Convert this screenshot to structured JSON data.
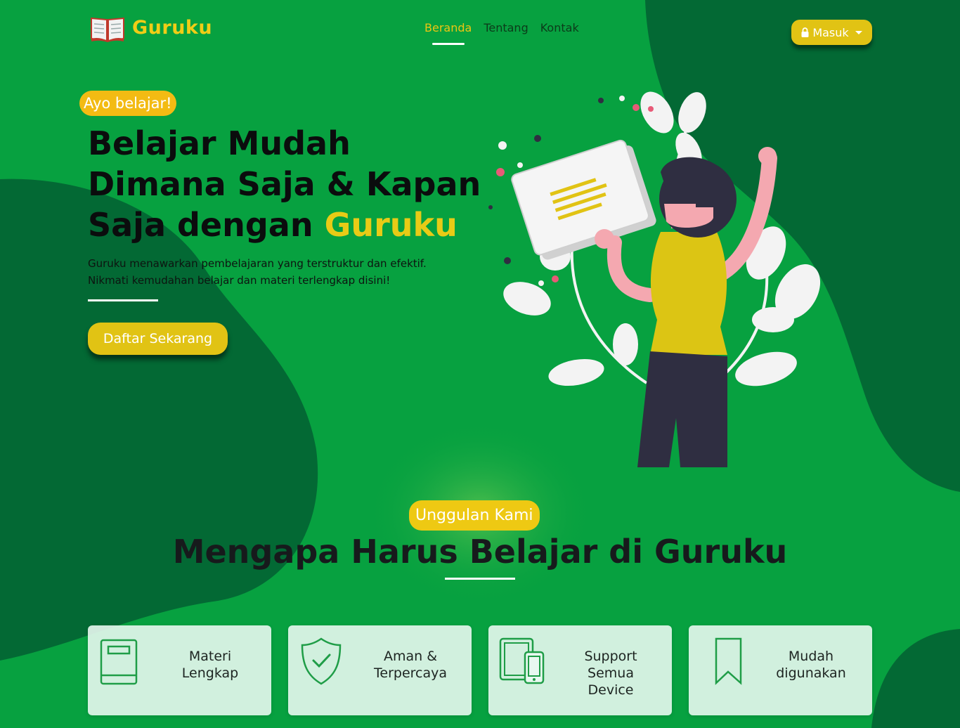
{
  "brand": {
    "name": "Guruku",
    "icon": "open-book-icon"
  },
  "nav": {
    "items": [
      "Beranda",
      "Tentang",
      "Kontak"
    ],
    "active": "Beranda"
  },
  "login": {
    "label": "Masuk",
    "icon": "lock-icon"
  },
  "hero": {
    "badge": "Ayo belajar!",
    "title_line1": "Belajar Mudah",
    "title_line2": "Dimana Saja & Kapan",
    "title_line3_prefix": "Saja dengan",
    "title_accent": "Guruku",
    "desc_line1": "Guruku menawarkan pembelajaran yang terstruktur dan efektif.",
    "desc_line2": "Nikmati kemudahan belajar dan materi terlengkap disini!",
    "cta": "Daftar Sekarang"
  },
  "features": {
    "badge": "Unggulan Kami",
    "title": "Mengapa Harus Belajar di Guruku",
    "cards": [
      {
        "line1": "Materi",
        "line2": "Lengkap",
        "line3": "",
        "icon": "book-icon"
      },
      {
        "line1": "Aman &",
        "line2": "Terpercaya",
        "line3": "",
        "icon": "shield-check-icon"
      },
      {
        "line1": "Support",
        "line2": "Semua",
        "line3": "Device",
        "icon": "devices-icon"
      },
      {
        "line1": "Mudah",
        "line2": "digunakan",
        "line3": "",
        "icon": "bookmark-icon"
      }
    ]
  },
  "colors": {
    "background": "#07a140",
    "dark_green": "#036934",
    "accent_yellow": "#e1c314",
    "badge_orange": "#f3bb13",
    "card_bg": "#e8f8f0"
  }
}
